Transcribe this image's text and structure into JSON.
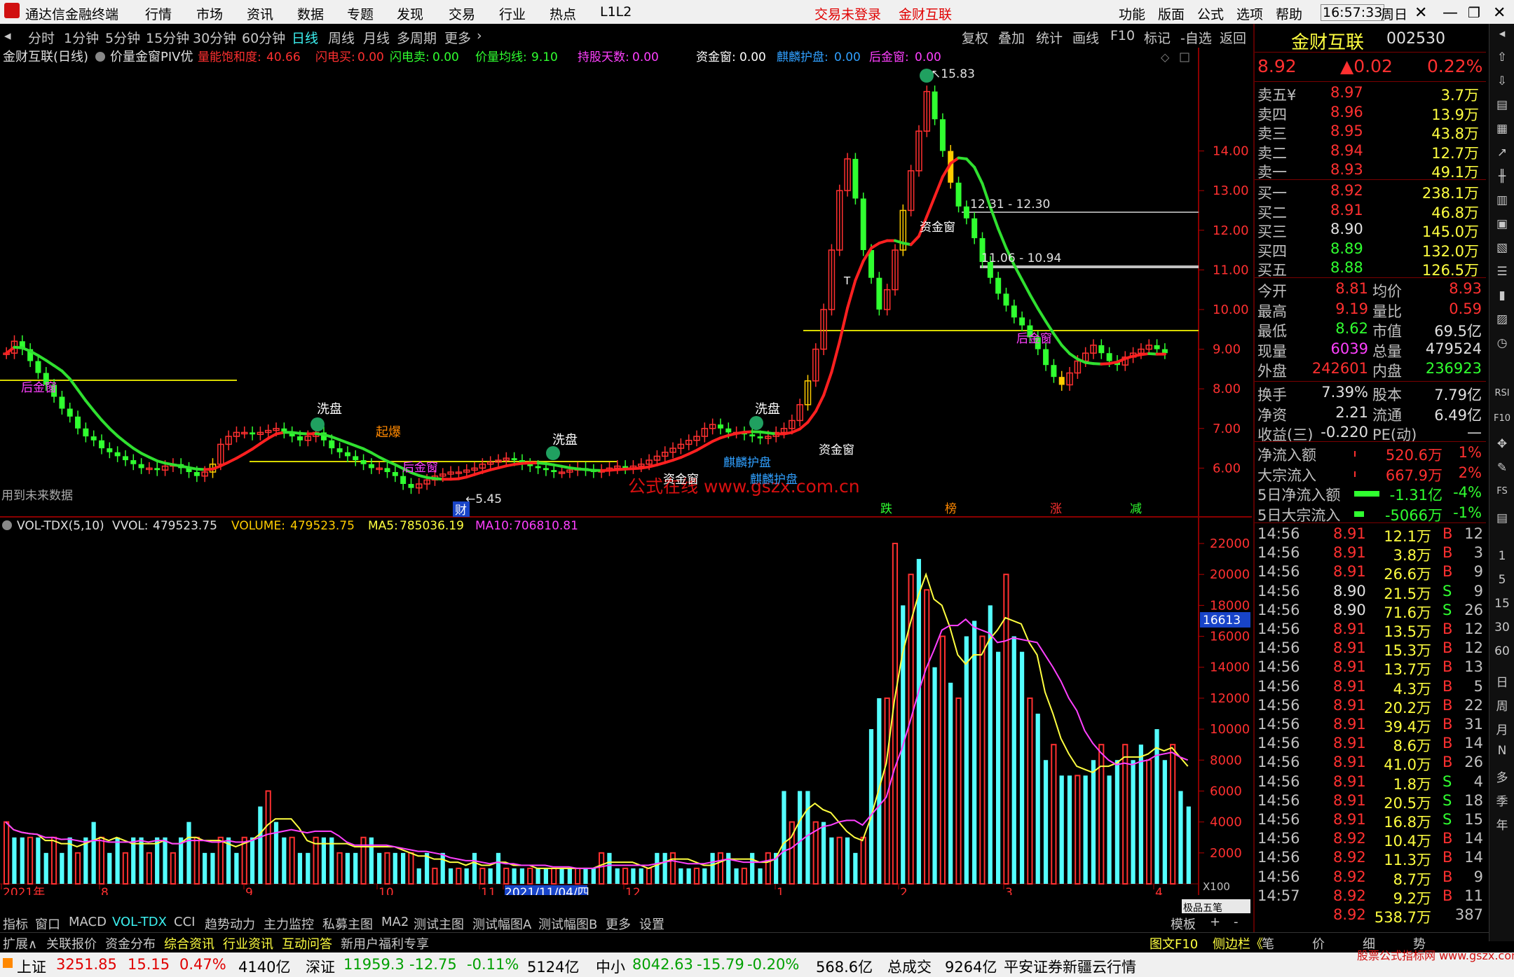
{
  "titlebar": {
    "app_name": "通达信金融终端",
    "menus": [
      "行情",
      "市场",
      "资讯",
      "数据",
      "专题",
      "发现",
      "交易",
      "行业",
      "热点",
      "L1L2"
    ],
    "login_status": "交易未登录",
    "stock_name": "金财互联",
    "right_menus": [
      "功能",
      "版面",
      "公式",
      "选项",
      "帮助"
    ],
    "time": "16:57:33",
    "weekday": "周日"
  },
  "periods": {
    "items": [
      "分时",
      "1分钟",
      "5分钟",
      "15分钟",
      "30分钟",
      "60分钟",
      "日线",
      "周线",
      "月线",
      "多周期",
      "更多"
    ],
    "active": "日线",
    "tools": [
      "复权",
      "叠加",
      "统计",
      "画线",
      "F10",
      "标记",
      "-自选",
      "返回"
    ]
  },
  "main_chart": {
    "title": "金财互联(日线)",
    "indicator_name": "价量金窗PIV优",
    "fields": [
      {
        "label": "量能饱和度:",
        "value": "40.66",
        "color": "#ff3030"
      },
      {
        "label": "闪电买:",
        "value": "0.00",
        "color": "#ff3030"
      },
      {
        "label": "闪电卖:",
        "value": "0.00",
        "color": "#30ff30"
      },
      {
        "label": "价量均线:",
        "value": "9.10",
        "color": "#30ff30"
      },
      {
        "label": "持股天数:",
        "value": "0.00",
        "color": "#ff40ff"
      },
      {
        "label": "资金窗:",
        "value": "0.00",
        "color": "#ffffff"
      },
      {
        "label": "麒麟护盘:",
        "value": "0.00",
        "color": "#30a0ff"
      },
      {
        "label": "后金窗:",
        "value": "0.00",
        "color": "#ff40ff"
      }
    ],
    "price_ticks": [
      "14.00",
      "13.00",
      "12.00",
      "11.00",
      "10.00",
      "9.00",
      "8.00",
      "7.00",
      "6.00"
    ],
    "annotations": {
      "high": "15.83",
      "low": "5.45",
      "range1": "12.31 - 12.30",
      "range2": "11.06 - 10.94",
      "future_note": "用到未来数据",
      "watermark": "公式在线 www.gszx.com.cn",
      "wash1": "洗盘",
      "wash2": "洗盘",
      "wash3": "洗盘",
      "qibao": "起爆",
      "hou_jin_chuang": "后金窗",
      "zi_jin_chuang": "资金窗",
      "qilin": "麒麟护盘",
      "cai": "财",
      "die": "跌",
      "bang": "榜",
      "zhang": "涨",
      "jian": "减",
      "t_mark": "T"
    }
  },
  "vol_chart": {
    "title": "VOL-TDX(5,10)",
    "vvol_label": "VVOL:",
    "vvol": "479523.75",
    "volume_label": "VOLUME:",
    "volume": "479523.75",
    "ma5_label": "MA5:",
    "ma5": "785036.19",
    "ma10_label": "MA10:",
    "ma10": "706810.81",
    "ticks": [
      "22000",
      "20000",
      "18000",
      "16000",
      "14000",
      "12000",
      "10000",
      "8000",
      "6000",
      "4000",
      "2000"
    ],
    "cursor_value": "16613",
    "unit": "X100"
  },
  "chart_data": {
    "type": "bar",
    "title": "",
    "volume_ylim": [
      0,
      22000
    ],
    "price_ylim": [
      5.3,
      15.9
    ],
    "date_labels": [
      "2021年",
      "8",
      "9",
      "10",
      "11",
      "2021/11/04/四",
      "12",
      "1",
      "2",
      "3",
      "4"
    ],
    "volume_levels": [
      4,
      3,
      3,
      3,
      3,
      2,
      3,
      2,
      3,
      2,
      3,
      4,
      3,
      2,
      3,
      2,
      3,
      3,
      2,
      3,
      3,
      2,
      3,
      4,
      3,
      2,
      2,
      3,
      3,
      2,
      3,
      3,
      5,
      6,
      4,
      3,
      3,
      2,
      2,
      3,
      3,
      3,
      2,
      2,
      2,
      3,
      3,
      2,
      2,
      2,
      2,
      2,
      1,
      2,
      1,
      2,
      1,
      1,
      1,
      2,
      1,
      1,
      2,
      1,
      1,
      1,
      1,
      1,
      1,
      1,
      1,
      1,
      1,
      1,
      1,
      2,
      2,
      1,
      1,
      1,
      1,
      1,
      2,
      2,
      2,
      1,
      1,
      1,
      1,
      2,
      2,
      2,
      1,
      1,
      2,
      1,
      2,
      2,
      6,
      4,
      6,
      6,
      4,
      4,
      3,
      3,
      3,
      2,
      3,
      10,
      12,
      12,
      22,
      18,
      20,
      21,
      19,
      14,
      16,
      13,
      12,
      16,
      17,
      16,
      18,
      15,
      20,
      16,
      15,
      12,
      11,
      8,
      9,
      7,
      7,
      7,
      7,
      8,
      9,
      7,
      8,
      9,
      8,
      9,
      8,
      10,
      8,
      9,
      6,
      5
    ]
  },
  "quote": {
    "name": "金财互联",
    "code": "002530",
    "price": "8.92",
    "change": "▲0.02",
    "pct": "0.22%",
    "asks": [
      {
        "label": "卖五¥",
        "price": "8.97",
        "vol": "3.7万"
      },
      {
        "label": "卖四",
        "price": "8.96",
        "vol": "13.9万"
      },
      {
        "label": "卖三",
        "price": "8.95",
        "vol": "43.8万"
      },
      {
        "label": "卖二",
        "price": "8.94",
        "vol": "12.7万"
      },
      {
        "label": "卖一",
        "price": "8.93",
        "vol": "49.1万"
      }
    ],
    "bids": [
      {
        "label": "买一",
        "price": "8.92",
        "vol": "238.1万"
      },
      {
        "label": "买二",
        "price": "8.91",
        "vol": "46.8万"
      },
      {
        "label": "买三",
        "price": "8.90",
        "vol": "145.0万"
      },
      {
        "label": "买四",
        "price": "8.89",
        "vol": "132.0万"
      },
      {
        "label": "买五",
        "price": "8.88",
        "vol": "126.5万"
      }
    ],
    "stats": [
      {
        "l1": "今开",
        "v1": "8.81",
        "l2": "均价",
        "v2": "8.93"
      },
      {
        "l1": "最高",
        "v1": "9.19",
        "l2": "量比",
        "v2": "0.59"
      },
      {
        "l1": "最低",
        "v1": "8.62",
        "l2": "市值",
        "v2": "69.5亿"
      },
      {
        "l1": "现量",
        "v1": "6039",
        "l2": "总量",
        "v2": "479524"
      },
      {
        "l1": "外盘",
        "v1": "242601",
        "l2": "内盘",
        "v2": "236923"
      }
    ],
    "stats2": [
      {
        "l1": "换手",
        "v1": "7.39%",
        "l2": "股本",
        "v2": "7.79亿"
      },
      {
        "l1": "净资",
        "v1": "2.21",
        "l2": "流通",
        "v2": "6.49亿"
      },
      {
        "l1": "收益(三)",
        "v1": "-0.220",
        "l2": "PE(动)",
        "v2": "—"
      }
    ],
    "flows": [
      {
        "label": "净流入额",
        "value": "520.6万",
        "pct": "1%",
        "color": "#ff3030"
      },
      {
        "label": "大宗流入",
        "value": "667.9万",
        "pct": "2%",
        "color": "#ff3030"
      },
      {
        "label": "5日净流入额",
        "value": "-1.31亿",
        "pct": "-4%",
        "color": "#30ff30"
      },
      {
        "label": "5日大宗流入",
        "value": "-5066万",
        "pct": "-1%",
        "color": "#30ff30"
      }
    ],
    "ticks": [
      {
        "t": "14:56",
        "p": "8.91",
        "v": "12.1万",
        "s": "B",
        "n": "12"
      },
      {
        "t": "14:56",
        "p": "8.91",
        "v": "3.8万",
        "s": "B",
        "n": "3"
      },
      {
        "t": "14:56",
        "p": "8.91",
        "v": "26.6万",
        "s": "B",
        "n": "9"
      },
      {
        "t": "14:56",
        "p": "8.90",
        "v": "21.5万",
        "s": "S",
        "n": "9"
      },
      {
        "t": "14:56",
        "p": "8.90",
        "v": "71.6万",
        "s": "S",
        "n": "26"
      },
      {
        "t": "14:56",
        "p": "8.91",
        "v": "13.5万",
        "s": "B",
        "n": "12"
      },
      {
        "t": "14:56",
        "p": "8.91",
        "v": "15.3万",
        "s": "B",
        "n": "12"
      },
      {
        "t": "14:56",
        "p": "8.91",
        "v": "13.7万",
        "s": "B",
        "n": "13"
      },
      {
        "t": "14:56",
        "p": "8.91",
        "v": "4.3万",
        "s": "B",
        "n": "5"
      },
      {
        "t": "14:56",
        "p": "8.91",
        "v": "20.2万",
        "s": "B",
        "n": "22"
      },
      {
        "t": "14:56",
        "p": "8.91",
        "v": "39.4万",
        "s": "B",
        "n": "31"
      },
      {
        "t": "14:56",
        "p": "8.91",
        "v": "8.6万",
        "s": "B",
        "n": "14"
      },
      {
        "t": "14:56",
        "p": "8.91",
        "v": "41.0万",
        "s": "B",
        "n": "26"
      },
      {
        "t": "14:56",
        "p": "8.91",
        "v": "1.8万",
        "s": "S",
        "n": "4"
      },
      {
        "t": "14:56",
        "p": "8.91",
        "v": "20.5万",
        "s": "S",
        "n": "18"
      },
      {
        "t": "14:56",
        "p": "8.91",
        "v": "16.8万",
        "s": "S",
        "n": "15"
      },
      {
        "t": "14:56",
        "p": "8.92",
        "v": "10.4万",
        "s": "B",
        "n": "14"
      },
      {
        "t": "14:56",
        "p": "8.92",
        "v": "11.3万",
        "s": "B",
        "n": "14"
      },
      {
        "t": "14:56",
        "p": "8.92",
        "v": "8.7万",
        "s": "B",
        "n": "9"
      },
      {
        "t": "14:57",
        "p": "8.92",
        "v": "9.2万",
        "s": "B",
        "n": "11"
      },
      {
        "t": "",
        "p": "8.92",
        "v": "538.7万",
        "s": "",
        "n": "387"
      }
    ],
    "bottom_tabs": [
      "笔",
      "价",
      "细",
      "势"
    ]
  },
  "sidebar": {
    "labels": [
      "1",
      "5",
      "15",
      "30",
      "60",
      "日",
      "周",
      "月",
      "N",
      "多",
      "季",
      "年",
      "RSI",
      "F10"
    ]
  },
  "tabbar": {
    "items": [
      "指标",
      "窗口",
      "MACD",
      "VOL-TDX",
      "CCI",
      "趋势动力",
      "主力监控",
      "私募主图",
      "MA2",
      "测试主图",
      "测试幅图A",
      "测试幅图B",
      "更多",
      "设置"
    ],
    "active": "VOL-TDX",
    "right": [
      "模板",
      "+",
      "-"
    ],
    "widget": "极品五笔"
  },
  "extbar": {
    "items": [
      "扩展∧",
      "关联报价",
      "资金分布",
      "综合资讯",
      "行业资讯",
      "互动问答",
      "新用户福利专享"
    ],
    "right": [
      "图文F10",
      "侧边栏《",
      "笔",
      "价",
      "细",
      "势"
    ]
  },
  "status": {
    "sh_label": "上证",
    "sh_val": "3251.85",
    "sh_chg": "15.15",
    "sh_pct": "0.47%",
    "sh_amt": "4140亿",
    "sz_label": "深证",
    "sz_val": "11959.3",
    "sz_chg": "-12.75",
    "sz_pct": "-0.11%",
    "sz_amt": "5124亿",
    "zx_label": "中小",
    "zx_val": "8042.63",
    "zx_chg": "-15.79",
    "zx_pct": "-0.20%",
    "zx_amt": "568.6亿",
    "total_label": "总成交",
    "total_amt": "9264亿",
    "broker": "平安证券新疆云行情",
    "watermark": "股票公式指标网 www.gszx.com"
  }
}
